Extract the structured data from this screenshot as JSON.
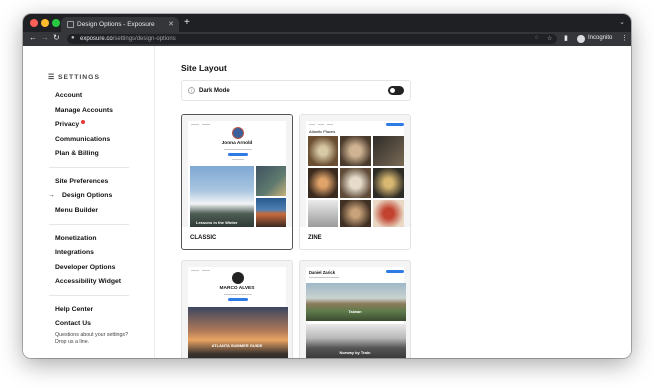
{
  "browser": {
    "tab_title": "Design Options - Exposure",
    "url_host": "exposure.co",
    "url_path": "/settings/design-options",
    "profile_label": "Incognito",
    "colors": {
      "chrome_dark": "#1f2023",
      "chrome_mid": "#35363a",
      "close": "#ff5f57",
      "minimize": "#febc2e",
      "maximize": "#28c840"
    }
  },
  "sidebar": {
    "heading": "SETTINGS",
    "group1": [
      "Account",
      "Manage Accounts",
      "Privacy",
      "Communications",
      "Plan & Billing"
    ],
    "group2": [
      "Site Preferences",
      "Design Options",
      "Menu Builder"
    ],
    "active_item": "Design Options",
    "group3": [
      "Monetization",
      "Integrations",
      "Developer Options",
      "Accessibility Widget"
    ],
    "group4": [
      "Help Center",
      "Contact Us"
    ],
    "help_text_line1": "Questions about your settings?",
    "help_text_line2": "Drop us a line."
  },
  "main": {
    "section_title": "Site Layout",
    "dark_mode_label": "Dark Mode",
    "dark_mode_on": true,
    "themes": [
      {
        "label": "CLASSIC",
        "selected": true,
        "profile_name": "Jonna Arnold",
        "caption": "Lessons in the Winter"
      },
      {
        "label": "ZINE",
        "selected": false,
        "profile_name": "Atlantic Places"
      },
      {
        "label": "",
        "selected": false,
        "profile_name": "MARCO ALVES",
        "caption": "ATLANTA SUMMER GUIDE"
      },
      {
        "label": "",
        "selected": false,
        "profile_name": "Daniel Zarick",
        "caption1": "Taiwan",
        "caption2": "Norway by Train"
      }
    ],
    "accent_color": "#2d7be5",
    "badge_color": "#e53935"
  }
}
